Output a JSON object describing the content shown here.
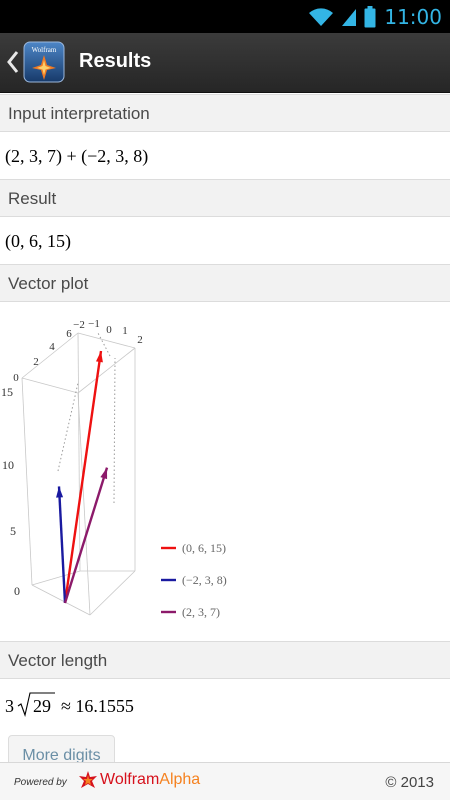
{
  "statusbar": {
    "time": "11:00",
    "icons": [
      "wifi-icon",
      "signal-icon",
      "battery-icon"
    ]
  },
  "actionbar": {
    "title": "Results",
    "logo_text": "Wolfram"
  },
  "pods": {
    "input": {
      "title": "Input interpretation",
      "content": "(2, 3, 7) + (−2, 3, 8)"
    },
    "result": {
      "title": "Result",
      "content": "(0, 6, 15)"
    },
    "plot": {
      "title": "Vector plot"
    },
    "length": {
      "title": "Vector length",
      "coefficient": "3",
      "radicand": "29",
      "approx": "≈ 16.1555",
      "more_label": "More digits"
    }
  },
  "chart_data": {
    "type": "vector3d",
    "series": [
      {
        "name": "(0, 6, 15)",
        "vector": [
          0,
          6,
          15
        ],
        "color": "#ee1111"
      },
      {
        "name": "(−2, 3, 8)",
        "vector": [
          -2,
          3,
          8
        ],
        "color": "#1a1aa0"
      },
      {
        "name": "(2, 3, 7)",
        "vector": [
          2,
          3,
          7
        ],
        "color": "#8c1a6a"
      }
    ],
    "axes": {
      "x_ticks": [
        "−2",
        "−1",
        "0",
        "1",
        "2"
      ],
      "y_ticks": [
        "0",
        "2",
        "4",
        "6"
      ],
      "z_ticks": [
        "0",
        "5",
        "10",
        "15"
      ]
    },
    "legend": "right"
  },
  "footer": {
    "powered_by": "Powered by",
    "brand_a": "Wolfram",
    "brand_b": "Alpha",
    "copyright": "© 2013"
  }
}
